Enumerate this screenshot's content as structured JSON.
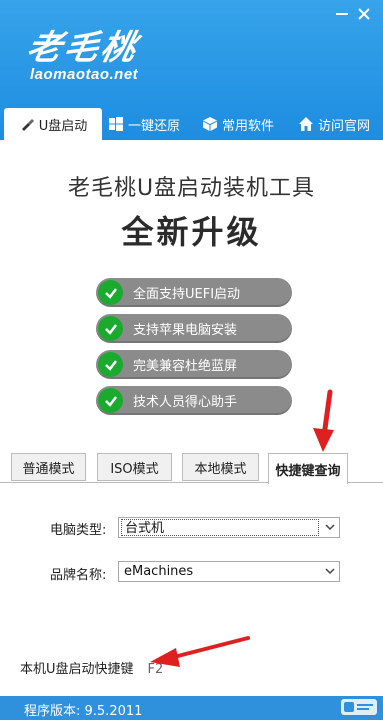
{
  "header": {
    "logo_text": "老毛桃",
    "logo_url": "laomaotao.net"
  },
  "nav": {
    "items": [
      {
        "label": "U盘启动",
        "icon": "usb-icon"
      },
      {
        "label": "一键还原",
        "icon": "windows-icon"
      },
      {
        "label": "常用软件",
        "icon": "box-icon"
      },
      {
        "label": "访问官网",
        "icon": "home-icon"
      }
    ],
    "active_index": 0
  },
  "main": {
    "title": "老毛桃U盘启动装机工具",
    "subtitle": "全新升级",
    "features": [
      "全面支持UEFI启动",
      "支持苹果电脑安装",
      "完美兼容杜绝蓝屏",
      "技术人员得心助手"
    ]
  },
  "mode_tabs": {
    "items": [
      "普通模式",
      "ISO模式",
      "本地模式",
      "快捷键查询"
    ],
    "active_index": 3
  },
  "form": {
    "computer_type_label": "电脑类型:",
    "computer_type_value": "台式机",
    "brand_label": "品牌名称:",
    "brand_value": "eMachines"
  },
  "bottom": {
    "hotkey_label": "本机U盘启动快捷键",
    "hotkey_value": "F2"
  },
  "status": {
    "version_text": "程序版本: 9.5.2011"
  },
  "colors": {
    "header_blue": "#2196e8",
    "check_green": "#1aab2e",
    "feature_gray": "#8b8b8b",
    "arrow_red": "#e02020"
  }
}
